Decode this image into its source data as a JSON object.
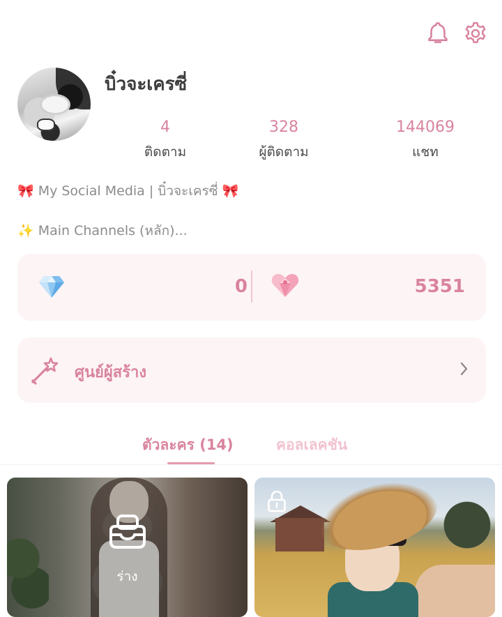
{
  "header": {
    "icons": [
      "bell-icon",
      "gear-icon"
    ]
  },
  "profile": {
    "username": "บิ๋วจะเครซี่",
    "stats": [
      {
        "value": "4",
        "label": "ติดตาม"
      },
      {
        "value": "328",
        "label": "ผู้ติดตาม"
      },
      {
        "value": "144069",
        "label": "แชท"
      }
    ],
    "bio_line_1": "🎀 My Social Media | บิ๋วจะเครซี่ 🎀",
    "bio_line_2": "✨ Main Channels (หลัก)..."
  },
  "wallet": {
    "gems": "0",
    "hearts": "5351",
    "icons": [
      "diamond-icon",
      "heart-gem-icon"
    ]
  },
  "creator_center": {
    "label": "ศูนย์ผู้สร้าง",
    "icons": [
      "magic-wand-icon",
      "chevron-right-icon"
    ]
  },
  "tabs": [
    {
      "label": "ตัวละคร (14)",
      "active": true
    },
    {
      "label": "คอลเลคชัน",
      "active": false
    }
  ],
  "cards": [
    {
      "status_label": "ร่าง",
      "icon": "draft-box-icon"
    },
    {
      "icon": "lock-icon"
    }
  ],
  "colors": {
    "accent": "#d9849e",
    "accent_light": "#f2c3d0",
    "card_bg": "#fdf4f6"
  }
}
